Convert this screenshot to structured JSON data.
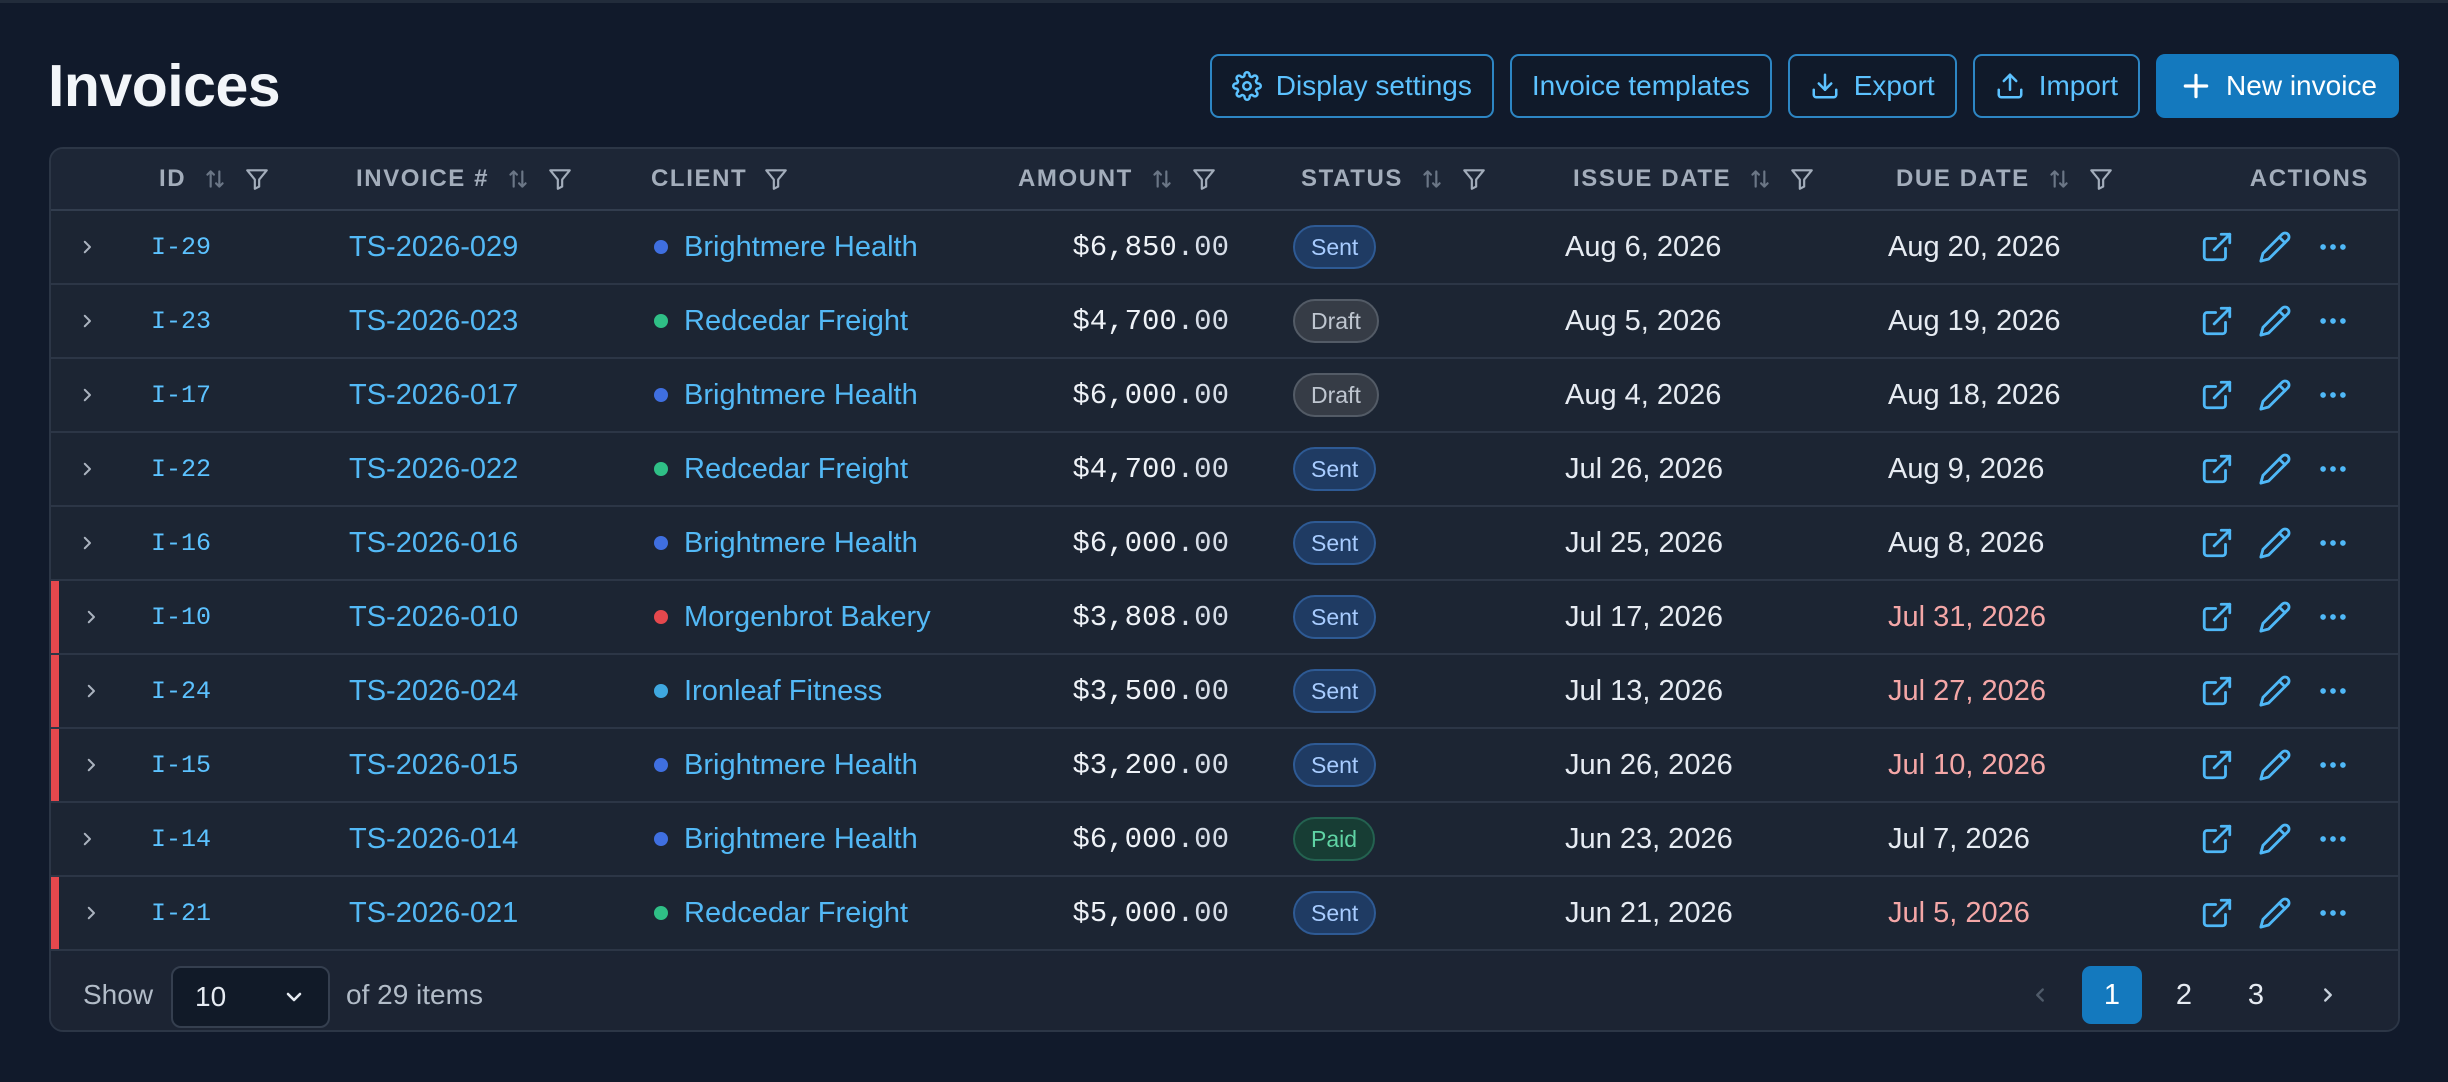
{
  "page": {
    "title": "Invoices"
  },
  "toolbar": {
    "display_settings": "Display settings",
    "invoice_templates": "Invoice templates",
    "export": "Export",
    "import": "Import",
    "new_invoice": "New invoice"
  },
  "columns": {
    "id": "ID",
    "invoice_no": "INVOICE #",
    "client": "CLIENT",
    "amount": "AMOUNT",
    "status": "STATUS",
    "issue_date": "ISSUE DATE",
    "due_date": "DUE DATE",
    "actions": "ACTIONS"
  },
  "rows": [
    {
      "id": "I-29",
      "invoice": "TS-2026-029",
      "client": "Brightmere Health",
      "client_color": "#3f6fe0",
      "amount_whole": "$6,850",
      "amount_cents": ".00",
      "status": "Sent",
      "status_kind": "sent",
      "issue": "Aug 6, 2026",
      "due": "Aug 20, 2026",
      "overdue": false
    },
    {
      "id": "I-23",
      "invoice": "TS-2026-023",
      "client": "Redcedar Freight",
      "client_color": "#2fbf86",
      "amount_whole": "$4,700",
      "amount_cents": ".00",
      "status": "Draft",
      "status_kind": "draft",
      "issue": "Aug 5, 2026",
      "due": "Aug 19, 2026",
      "overdue": false
    },
    {
      "id": "I-17",
      "invoice": "TS-2026-017",
      "client": "Brightmere Health",
      "client_color": "#3f6fe0",
      "amount_whole": "$6,000",
      "amount_cents": ".00",
      "status": "Draft",
      "status_kind": "draft",
      "issue": "Aug 4, 2026",
      "due": "Aug 18, 2026",
      "overdue": false
    },
    {
      "id": "I-22",
      "invoice": "TS-2026-022",
      "client": "Redcedar Freight",
      "client_color": "#2fbf86",
      "amount_whole": "$4,700",
      "amount_cents": ".00",
      "status": "Sent",
      "status_kind": "sent",
      "issue": "Jul 26, 2026",
      "due": "Aug 9, 2026",
      "overdue": false
    },
    {
      "id": "I-16",
      "invoice": "TS-2026-016",
      "client": "Brightmere Health",
      "client_color": "#3f6fe0",
      "amount_whole": "$6,000",
      "amount_cents": ".00",
      "status": "Sent",
      "status_kind": "sent",
      "issue": "Jul 25, 2026",
      "due": "Aug 8, 2026",
      "overdue": false
    },
    {
      "id": "I-10",
      "invoice": "TS-2026-010",
      "client": "Morgenbrot Bakery",
      "client_color": "#e5484d",
      "amount_whole": "$3,808",
      "amount_cents": ".00",
      "status": "Sent",
      "status_kind": "sent",
      "issue": "Jul 17, 2026",
      "due": "Jul 31, 2026",
      "overdue": true
    },
    {
      "id": "I-24",
      "invoice": "TS-2026-024",
      "client": "Ironleaf Fitness",
      "client_color": "#3fa8e0",
      "amount_whole": "$3,500",
      "amount_cents": ".00",
      "status": "Sent",
      "status_kind": "sent",
      "issue": "Jul 13, 2026",
      "due": "Jul 27, 2026",
      "overdue": true
    },
    {
      "id": "I-15",
      "invoice": "TS-2026-015",
      "client": "Brightmere Health",
      "client_color": "#3f6fe0",
      "amount_whole": "$3,200",
      "amount_cents": ".00",
      "status": "Sent",
      "status_kind": "sent",
      "issue": "Jun 26, 2026",
      "due": "Jul 10, 2026",
      "overdue": true
    },
    {
      "id": "I-14",
      "invoice": "TS-2026-014",
      "client": "Brightmere Health",
      "client_color": "#3f6fe0",
      "amount_whole": "$6,000",
      "amount_cents": ".00",
      "status": "Paid",
      "status_kind": "paid",
      "issue": "Jun 23, 2026",
      "due": "Jul 7, 2026",
      "overdue": false
    },
    {
      "id": "I-21",
      "invoice": "TS-2026-021",
      "client": "Redcedar Freight",
      "client_color": "#2fbf86",
      "amount_whole": "$5,000",
      "amount_cents": ".00",
      "status": "Sent",
      "status_kind": "sent",
      "issue": "Jun 21, 2026",
      "due": "Jul 5, 2026",
      "overdue": true
    }
  ],
  "footer": {
    "show_label": "Show",
    "page_size": "10",
    "items_text": "of 29 items",
    "pages": [
      "1",
      "2",
      "3"
    ],
    "current_page": "1"
  },
  "colors": {
    "accent": "#1479be",
    "link": "#53b9f6",
    "overdue": "#e5484d"
  }
}
